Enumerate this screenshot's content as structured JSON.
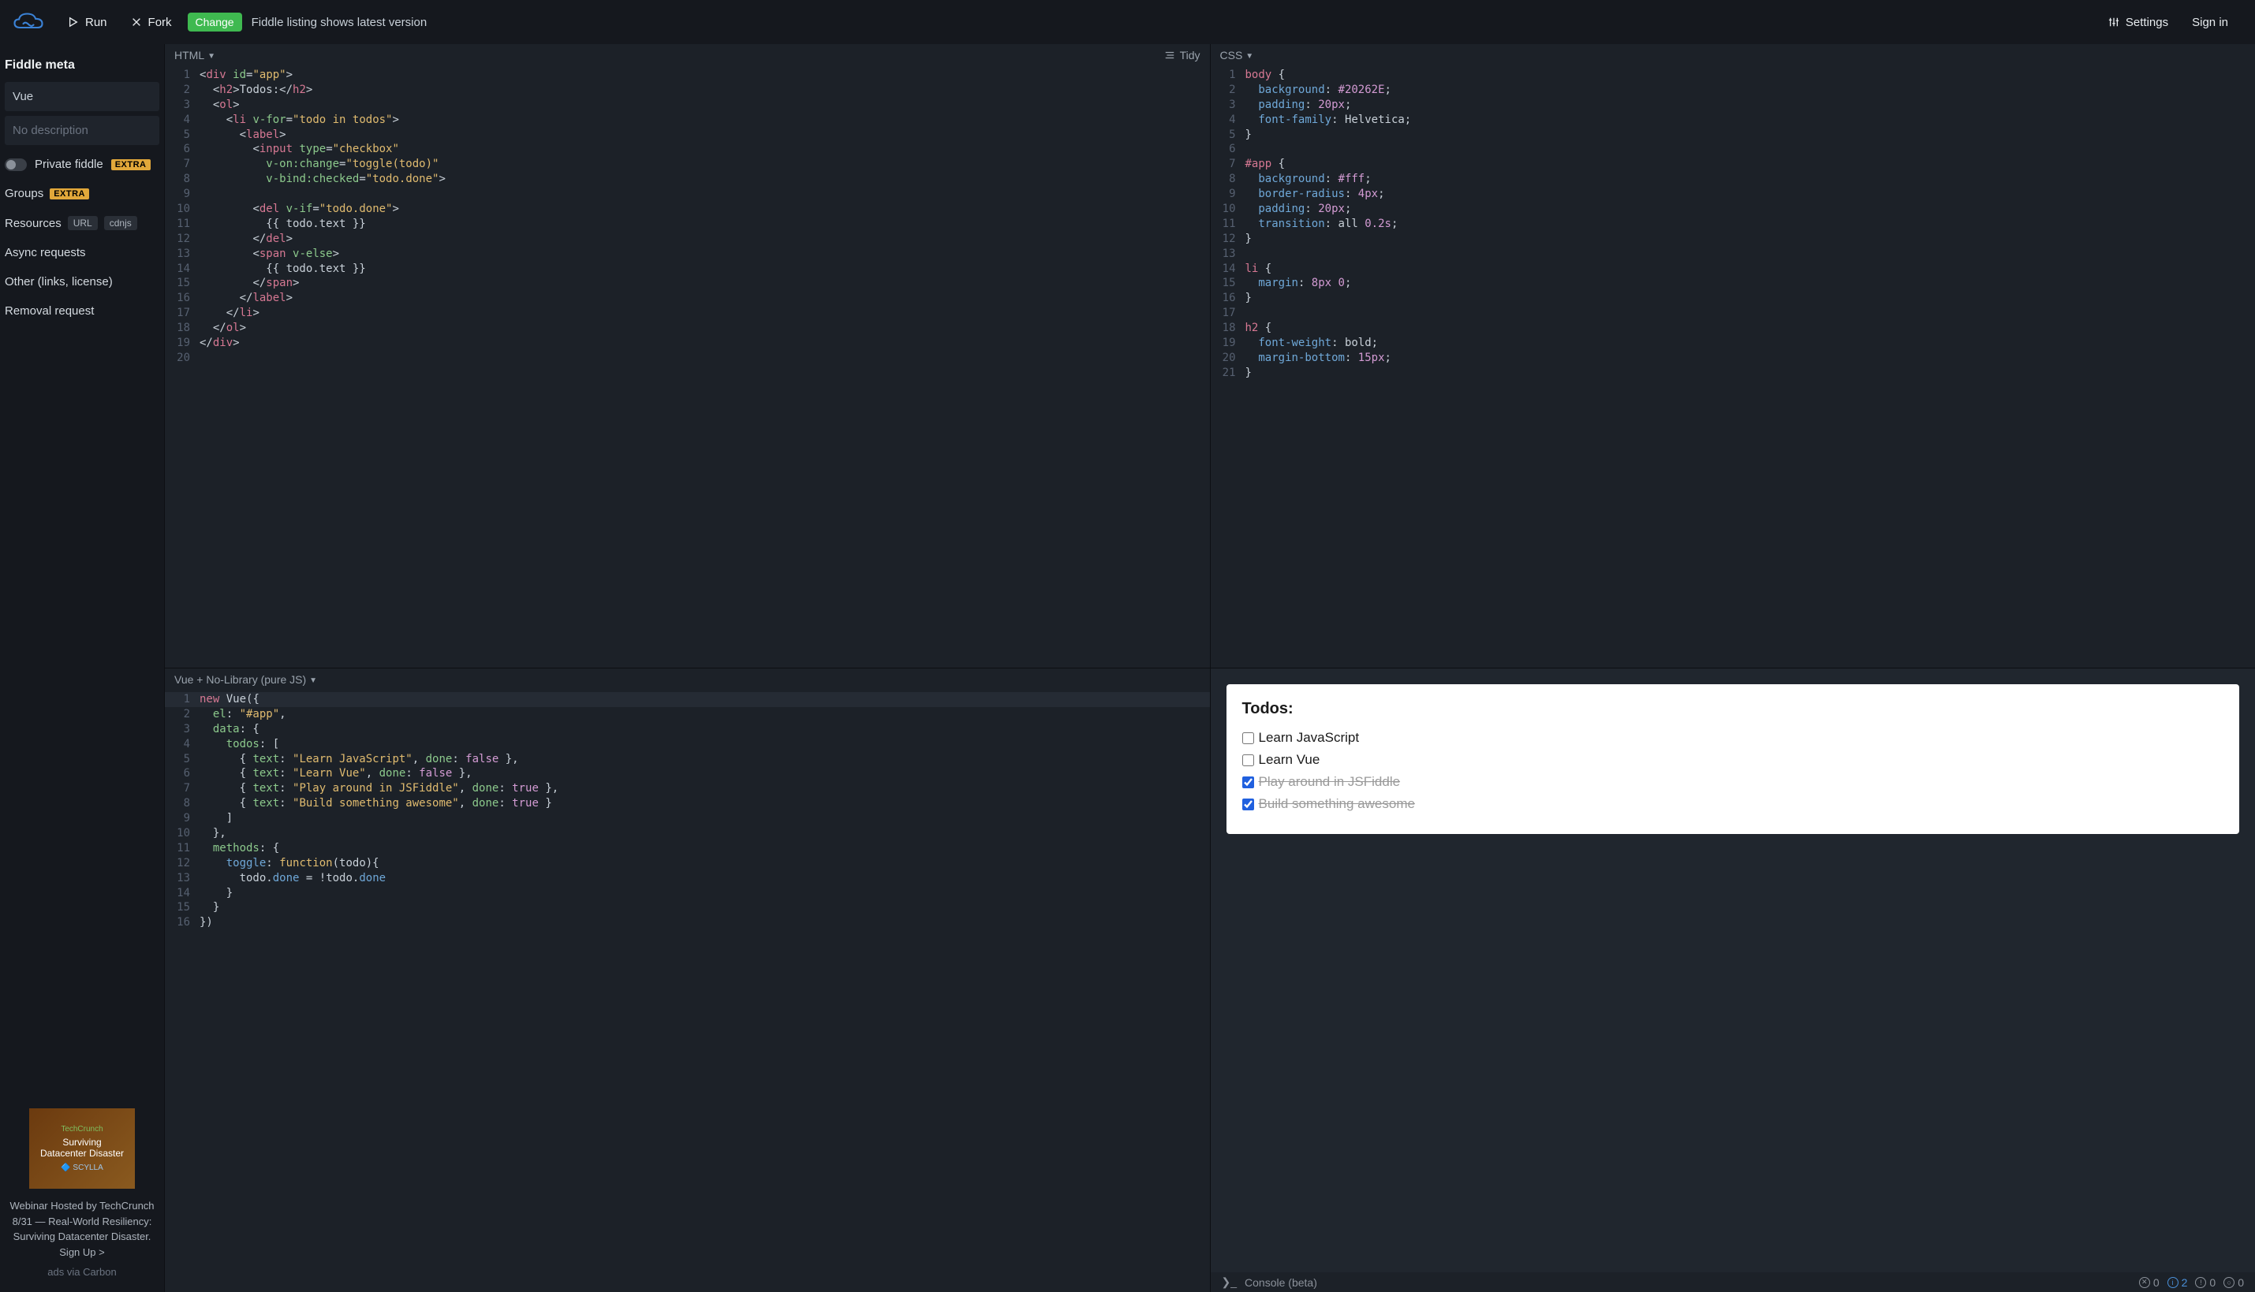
{
  "topbar": {
    "run_label": "Run",
    "fork_label": "Fork",
    "change_label": "Change",
    "message": "Fiddle listing shows latest version",
    "settings_label": "Settings",
    "signin_label": "Sign in"
  },
  "sidebar": {
    "title": "Fiddle meta",
    "name_value": "Vue",
    "desc_placeholder": "No description",
    "private_label": "Private fiddle",
    "extra_badge": "EXTRA",
    "groups_label": "Groups",
    "resources_label": "Resources",
    "resources_url": "URL",
    "resources_cdnjs": "cdnjs",
    "async_label": "Async requests",
    "other_label": "Other (links, license)",
    "removal_label": "Removal request",
    "ad": {
      "line1": "TechCrunch",
      "line2a": "Surviving",
      "line2b": "Datacenter Disaster",
      "line3": "🔷 SCYLLA",
      "text": "Webinar Hosted by TechCrunch 8/31 — Real-World Resiliency: Surviving Datacenter Disaster. Sign Up >",
      "via": "ads via Carbon"
    }
  },
  "panes": {
    "html_label": "HTML",
    "css_label": "CSS",
    "js_label": "Vue + No-Library (pure JS)",
    "tidy_label": "Tidy"
  },
  "html_code": [
    [
      {
        "c": "c-punc",
        "t": "<"
      },
      {
        "c": "c-tag",
        "t": "div"
      },
      {
        "c": "",
        "t": " "
      },
      {
        "c": "c-attr",
        "t": "id"
      },
      {
        "c": "c-eq",
        "t": "="
      },
      {
        "c": "c-str",
        "t": "\"app\""
      },
      {
        "c": "c-punc",
        "t": ">"
      }
    ],
    [
      {
        "c": "",
        "t": "  "
      },
      {
        "c": "c-punc",
        "t": "<"
      },
      {
        "c": "c-tag",
        "t": "h2"
      },
      {
        "c": "c-punc",
        "t": ">"
      },
      {
        "c": "",
        "t": "Todos:"
      },
      {
        "c": "c-punc",
        "t": "</"
      },
      {
        "c": "c-tag",
        "t": "h2"
      },
      {
        "c": "c-punc",
        "t": ">"
      }
    ],
    [
      {
        "c": "",
        "t": "  "
      },
      {
        "c": "c-punc",
        "t": "<"
      },
      {
        "c": "c-tag",
        "t": "ol"
      },
      {
        "c": "c-punc",
        "t": ">"
      }
    ],
    [
      {
        "c": "",
        "t": "    "
      },
      {
        "c": "c-punc",
        "t": "<"
      },
      {
        "c": "c-tag",
        "t": "li"
      },
      {
        "c": "",
        "t": " "
      },
      {
        "c": "c-attr",
        "t": "v-for"
      },
      {
        "c": "c-eq",
        "t": "="
      },
      {
        "c": "c-str",
        "t": "\"todo in todos\""
      },
      {
        "c": "c-punc",
        "t": ">"
      }
    ],
    [
      {
        "c": "",
        "t": "      "
      },
      {
        "c": "c-punc",
        "t": "<"
      },
      {
        "c": "c-tag",
        "t": "label"
      },
      {
        "c": "c-punc",
        "t": ">"
      }
    ],
    [
      {
        "c": "",
        "t": "        "
      },
      {
        "c": "c-punc",
        "t": "<"
      },
      {
        "c": "c-tag",
        "t": "input"
      },
      {
        "c": "",
        "t": " "
      },
      {
        "c": "c-attr",
        "t": "type"
      },
      {
        "c": "c-eq",
        "t": "="
      },
      {
        "c": "c-str",
        "t": "\"checkbox\""
      }
    ],
    [
      {
        "c": "",
        "t": "          "
      },
      {
        "c": "c-attr",
        "t": "v-on:change"
      },
      {
        "c": "c-eq",
        "t": "="
      },
      {
        "c": "c-str",
        "t": "\"toggle(todo)\""
      }
    ],
    [
      {
        "c": "",
        "t": "          "
      },
      {
        "c": "c-attr",
        "t": "v-bind:checked"
      },
      {
        "c": "c-eq",
        "t": "="
      },
      {
        "c": "c-str",
        "t": "\"todo.done\""
      },
      {
        "c": "c-punc",
        "t": ">"
      }
    ],
    [
      {
        "c": "",
        "t": ""
      }
    ],
    [
      {
        "c": "",
        "t": "        "
      },
      {
        "c": "c-punc",
        "t": "<"
      },
      {
        "c": "c-tag",
        "t": "del"
      },
      {
        "c": "",
        "t": " "
      },
      {
        "c": "c-attr",
        "t": "v-if"
      },
      {
        "c": "c-eq",
        "t": "="
      },
      {
        "c": "c-str",
        "t": "\"todo.done\""
      },
      {
        "c": "c-punc",
        "t": ">"
      }
    ],
    [
      {
        "c": "",
        "t": "          {{ todo.text }}"
      }
    ],
    [
      {
        "c": "",
        "t": "        "
      },
      {
        "c": "c-punc",
        "t": "</"
      },
      {
        "c": "c-tag",
        "t": "del"
      },
      {
        "c": "c-punc",
        "t": ">"
      }
    ],
    [
      {
        "c": "",
        "t": "        "
      },
      {
        "c": "c-punc",
        "t": "<"
      },
      {
        "c": "c-tag",
        "t": "span"
      },
      {
        "c": "",
        "t": " "
      },
      {
        "c": "c-attr",
        "t": "v-else"
      },
      {
        "c": "c-punc",
        "t": ">"
      }
    ],
    [
      {
        "c": "",
        "t": "          {{ todo.text }}"
      }
    ],
    [
      {
        "c": "",
        "t": "        "
      },
      {
        "c": "c-punc",
        "t": "</"
      },
      {
        "c": "c-tag",
        "t": "span"
      },
      {
        "c": "c-punc",
        "t": ">"
      }
    ],
    [
      {
        "c": "",
        "t": "      "
      },
      {
        "c": "c-punc",
        "t": "</"
      },
      {
        "c": "c-tag",
        "t": "label"
      },
      {
        "c": "c-punc",
        "t": ">"
      }
    ],
    [
      {
        "c": "",
        "t": "    "
      },
      {
        "c": "c-punc",
        "t": "</"
      },
      {
        "c": "c-tag",
        "t": "li"
      },
      {
        "c": "c-punc",
        "t": ">"
      }
    ],
    [
      {
        "c": "",
        "t": "  "
      },
      {
        "c": "c-punc",
        "t": "</"
      },
      {
        "c": "c-tag",
        "t": "ol"
      },
      {
        "c": "c-punc",
        "t": ">"
      }
    ],
    [
      {
        "c": "c-punc",
        "t": "</"
      },
      {
        "c": "c-tag",
        "t": "div"
      },
      {
        "c": "c-punc",
        "t": ">"
      }
    ],
    [
      {
        "c": "",
        "t": ""
      }
    ]
  ],
  "css_code": [
    [
      {
        "c": "c-sel",
        "t": "body"
      },
      {
        "c": "",
        "t": " "
      },
      {
        "c": "c-brace",
        "t": "{"
      }
    ],
    [
      {
        "c": "",
        "t": "  "
      },
      {
        "c": "c-prop",
        "t": "background"
      },
      {
        "c": "c-punc",
        "t": ": "
      },
      {
        "c": "c-hex",
        "t": "#20262E"
      },
      {
        "c": "c-punc",
        "t": ";"
      }
    ],
    [
      {
        "c": "",
        "t": "  "
      },
      {
        "c": "c-prop",
        "t": "padding"
      },
      {
        "c": "c-punc",
        "t": ": "
      },
      {
        "c": "c-num",
        "t": "20px"
      },
      {
        "c": "c-punc",
        "t": ";"
      }
    ],
    [
      {
        "c": "",
        "t": "  "
      },
      {
        "c": "c-prop",
        "t": "font-family"
      },
      {
        "c": "c-punc",
        "t": ": "
      },
      {
        "c": "",
        "t": "Helvetica"
      },
      {
        "c": "c-punc",
        "t": ";"
      }
    ],
    [
      {
        "c": "c-brace",
        "t": "}"
      }
    ],
    [
      {
        "c": "",
        "t": ""
      }
    ],
    [
      {
        "c": "c-sel",
        "t": "#app"
      },
      {
        "c": "",
        "t": " "
      },
      {
        "c": "c-brace",
        "t": "{"
      }
    ],
    [
      {
        "c": "",
        "t": "  "
      },
      {
        "c": "c-prop",
        "t": "background"
      },
      {
        "c": "c-punc",
        "t": ": "
      },
      {
        "c": "c-hex",
        "t": "#fff"
      },
      {
        "c": "c-punc",
        "t": ";"
      }
    ],
    [
      {
        "c": "",
        "t": "  "
      },
      {
        "c": "c-prop",
        "t": "border-radius"
      },
      {
        "c": "c-punc",
        "t": ": "
      },
      {
        "c": "c-num",
        "t": "4px"
      },
      {
        "c": "c-punc",
        "t": ";"
      }
    ],
    [
      {
        "c": "",
        "t": "  "
      },
      {
        "c": "c-prop",
        "t": "padding"
      },
      {
        "c": "c-punc",
        "t": ": "
      },
      {
        "c": "c-num",
        "t": "20px"
      },
      {
        "c": "c-punc",
        "t": ";"
      }
    ],
    [
      {
        "c": "",
        "t": "  "
      },
      {
        "c": "c-prop",
        "t": "transition"
      },
      {
        "c": "c-punc",
        "t": ": "
      },
      {
        "c": "",
        "t": "all "
      },
      {
        "c": "c-num",
        "t": "0.2s"
      },
      {
        "c": "c-punc",
        "t": ";"
      }
    ],
    [
      {
        "c": "c-brace",
        "t": "}"
      }
    ],
    [
      {
        "c": "",
        "t": ""
      }
    ],
    [
      {
        "c": "c-sel",
        "t": "li"
      },
      {
        "c": "",
        "t": " "
      },
      {
        "c": "c-brace",
        "t": "{"
      }
    ],
    [
      {
        "c": "",
        "t": "  "
      },
      {
        "c": "c-prop",
        "t": "margin"
      },
      {
        "c": "c-punc",
        "t": ": "
      },
      {
        "c": "c-num",
        "t": "8px 0"
      },
      {
        "c": "c-punc",
        "t": ";"
      }
    ],
    [
      {
        "c": "c-brace",
        "t": "}"
      }
    ],
    [
      {
        "c": "",
        "t": ""
      }
    ],
    [
      {
        "c": "c-sel",
        "t": "h2"
      },
      {
        "c": "",
        "t": " "
      },
      {
        "c": "c-brace",
        "t": "{"
      }
    ],
    [
      {
        "c": "",
        "t": "  "
      },
      {
        "c": "c-prop",
        "t": "font-weight"
      },
      {
        "c": "c-punc",
        "t": ": "
      },
      {
        "c": "",
        "t": "bold"
      },
      {
        "c": "c-punc",
        "t": ";"
      }
    ],
    [
      {
        "c": "",
        "t": "  "
      },
      {
        "c": "c-prop",
        "t": "margin-bottom"
      },
      {
        "c": "c-punc",
        "t": ": "
      },
      {
        "c": "c-num",
        "t": "15px"
      },
      {
        "c": "c-punc",
        "t": ";"
      }
    ],
    [
      {
        "c": "c-brace",
        "t": "}"
      }
    ]
  ],
  "js_code": [
    [
      {
        "c": "c-builtin",
        "t": "new"
      },
      {
        "c": "",
        "t": " Vue"
      },
      {
        "c": "c-punc",
        "t": "({"
      }
    ],
    [
      {
        "c": "",
        "t": "  "
      },
      {
        "c": "c-key",
        "t": "el"
      },
      {
        "c": "c-punc",
        "t": ": "
      },
      {
        "c": "c-str",
        "t": "\"#app\""
      },
      {
        "c": "c-punc",
        "t": ","
      }
    ],
    [
      {
        "c": "",
        "t": "  "
      },
      {
        "c": "c-key",
        "t": "data"
      },
      {
        "c": "c-punc",
        "t": ": {"
      }
    ],
    [
      {
        "c": "",
        "t": "    "
      },
      {
        "c": "c-key",
        "t": "todos"
      },
      {
        "c": "c-punc",
        "t": ": ["
      }
    ],
    [
      {
        "c": "",
        "t": "      "
      },
      {
        "c": "c-punc",
        "t": "{ "
      },
      {
        "c": "c-key",
        "t": "text"
      },
      {
        "c": "c-punc",
        "t": ": "
      },
      {
        "c": "c-str",
        "t": "\"Learn JavaScript\""
      },
      {
        "c": "c-punc",
        "t": ", "
      },
      {
        "c": "c-key",
        "t": "done"
      },
      {
        "c": "c-punc",
        "t": ": "
      },
      {
        "c": "c-bool",
        "t": "false"
      },
      {
        "c": "c-punc",
        "t": " },"
      }
    ],
    [
      {
        "c": "",
        "t": "      "
      },
      {
        "c": "c-punc",
        "t": "{ "
      },
      {
        "c": "c-key",
        "t": "text"
      },
      {
        "c": "c-punc",
        "t": ": "
      },
      {
        "c": "c-str",
        "t": "\"Learn Vue\""
      },
      {
        "c": "c-punc",
        "t": ", "
      },
      {
        "c": "c-key",
        "t": "done"
      },
      {
        "c": "c-punc",
        "t": ": "
      },
      {
        "c": "c-bool",
        "t": "false"
      },
      {
        "c": "c-punc",
        "t": " },"
      }
    ],
    [
      {
        "c": "",
        "t": "      "
      },
      {
        "c": "c-punc",
        "t": "{ "
      },
      {
        "c": "c-key",
        "t": "text"
      },
      {
        "c": "c-punc",
        "t": ": "
      },
      {
        "c": "c-str",
        "t": "\"Play around in JSFiddle\""
      },
      {
        "c": "c-punc",
        "t": ", "
      },
      {
        "c": "c-key",
        "t": "done"
      },
      {
        "c": "c-punc",
        "t": ": "
      },
      {
        "c": "c-bool",
        "t": "true"
      },
      {
        "c": "c-punc",
        "t": " },"
      }
    ],
    [
      {
        "c": "",
        "t": "      "
      },
      {
        "c": "c-punc",
        "t": "{ "
      },
      {
        "c": "c-key",
        "t": "text"
      },
      {
        "c": "c-punc",
        "t": ": "
      },
      {
        "c": "c-str",
        "t": "\"Build something awesome\""
      },
      {
        "c": "c-punc",
        "t": ", "
      },
      {
        "c": "c-key",
        "t": "done"
      },
      {
        "c": "c-punc",
        "t": ": "
      },
      {
        "c": "c-bool",
        "t": "true"
      },
      {
        "c": "c-punc",
        "t": " }"
      }
    ],
    [
      {
        "c": "",
        "t": "    "
      },
      {
        "c": "c-punc",
        "t": "]"
      }
    ],
    [
      {
        "c": "",
        "t": "  "
      },
      {
        "c": "c-punc",
        "t": "},"
      }
    ],
    [
      {
        "c": "",
        "t": "  "
      },
      {
        "c": "c-key",
        "t": "methods"
      },
      {
        "c": "c-punc",
        "t": ": {"
      }
    ],
    [
      {
        "c": "",
        "t": "    "
      },
      {
        "c": "c-prop",
        "t": "toggle"
      },
      {
        "c": "c-punc",
        "t": ": "
      },
      {
        "c": "c-func",
        "t": "function"
      },
      {
        "c": "c-punc",
        "t": "("
      },
      {
        "c": "c-var",
        "t": "todo"
      },
      {
        "c": "c-punc",
        "t": "){"
      }
    ],
    [
      {
        "c": "",
        "t": "      "
      },
      {
        "c": "c-var",
        "t": "todo"
      },
      {
        "c": "c-punc",
        "t": "."
      },
      {
        "c": "c-prop",
        "t": "done"
      },
      {
        "c": "",
        "t": " "
      },
      {
        "c": "c-punc",
        "t": "="
      },
      {
        "c": "",
        "t": " "
      },
      {
        "c": "c-punc",
        "t": "!"
      },
      {
        "c": "c-var",
        "t": "todo"
      },
      {
        "c": "c-punc",
        "t": "."
      },
      {
        "c": "c-prop",
        "t": "done"
      }
    ],
    [
      {
        "c": "",
        "t": "    "
      },
      {
        "c": "c-punc",
        "t": "}"
      }
    ],
    [
      {
        "c": "",
        "t": "  "
      },
      {
        "c": "c-punc",
        "t": "}"
      }
    ],
    [
      {
        "c": "c-punc",
        "t": "})"
      }
    ]
  ],
  "result": {
    "heading": "Todos:",
    "todos": [
      {
        "text": "Learn JavaScript",
        "done": false
      },
      {
        "text": "Learn Vue",
        "done": false
      },
      {
        "text": "Play around in JSFiddle",
        "done": true
      },
      {
        "text": "Build something awesome",
        "done": true
      }
    ]
  },
  "console": {
    "label": "Console (beta)",
    "counts": {
      "errors": "0",
      "info": "2",
      "warnings": "0",
      "logs": "0"
    }
  }
}
